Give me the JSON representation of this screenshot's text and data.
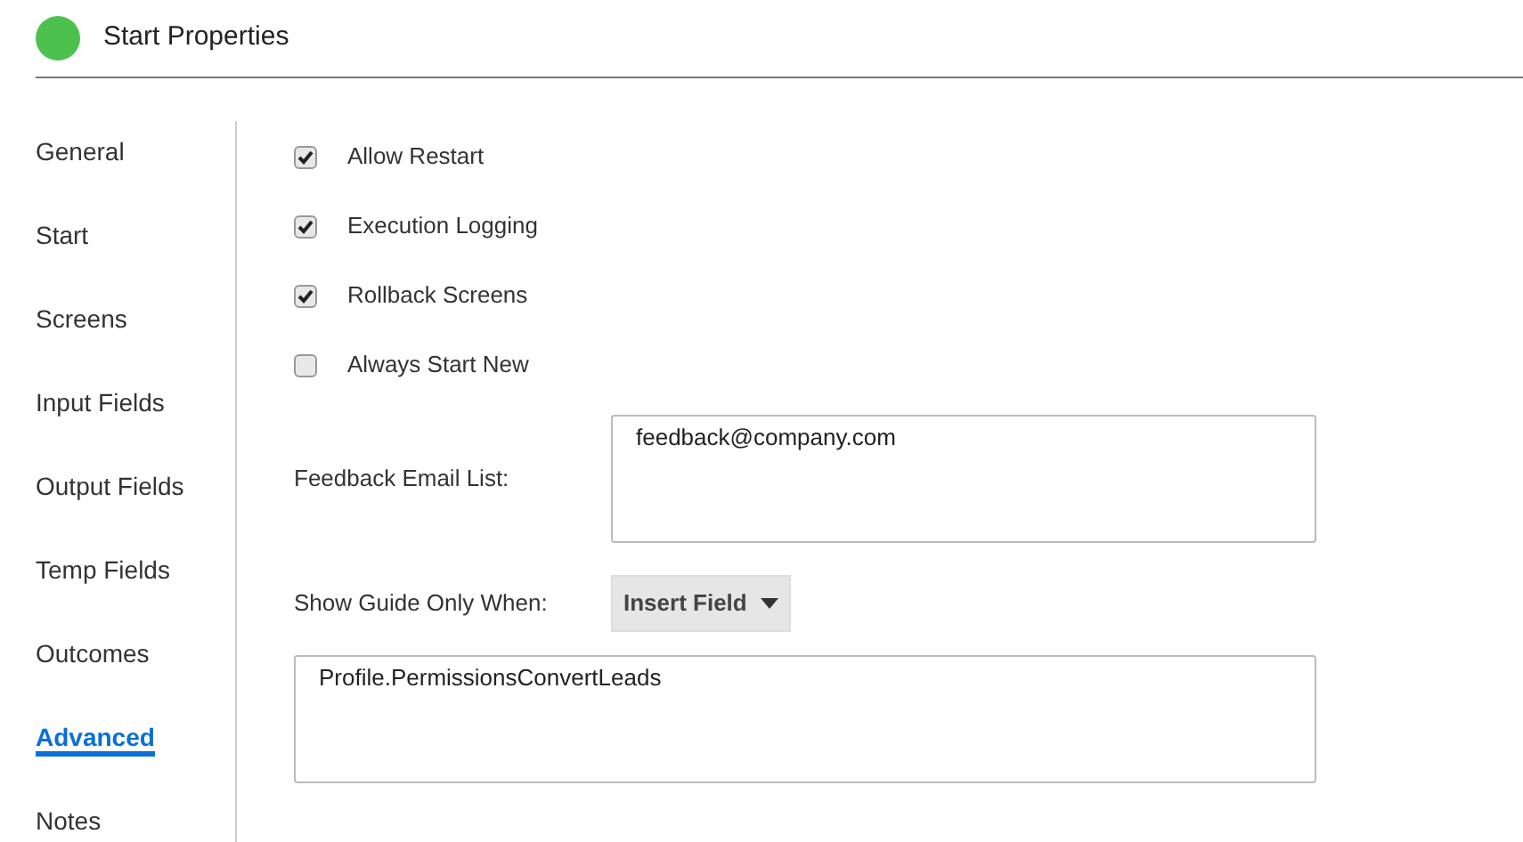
{
  "header": {
    "title": "Start Properties"
  },
  "sidebar": {
    "items": [
      {
        "label": "General",
        "selected": false
      },
      {
        "label": "Start",
        "selected": false
      },
      {
        "label": "Screens",
        "selected": false
      },
      {
        "label": "Input Fields",
        "selected": false
      },
      {
        "label": "Output Fields",
        "selected": false
      },
      {
        "label": "Temp Fields",
        "selected": false
      },
      {
        "label": "Outcomes",
        "selected": false
      },
      {
        "label": "Advanced",
        "selected": true
      },
      {
        "label": "Notes",
        "selected": false
      }
    ]
  },
  "options": [
    {
      "label": "Allow Restart",
      "checked": true
    },
    {
      "label": "Execution Logging",
      "checked": true
    },
    {
      "label": "Rollback Screens",
      "checked": true
    },
    {
      "label": "Always Start New",
      "checked": false
    }
  ],
  "feedback": {
    "label": "Feedback Email List:",
    "value": "feedback@company.com"
  },
  "guide": {
    "label": "Show Guide Only When:",
    "button": "Insert Field",
    "value": "Profile.PermissionsConvertLeads"
  }
}
